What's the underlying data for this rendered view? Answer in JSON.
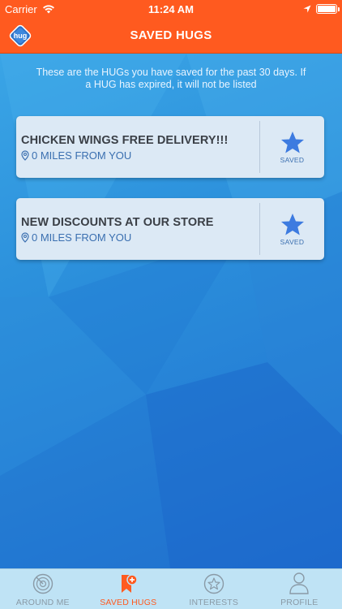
{
  "status_bar": {
    "carrier": "Carrier",
    "time": "11:24 AM"
  },
  "nav": {
    "title": "SAVED HUGS",
    "logo_text": "hug"
  },
  "intro_text": "These are the HUGs you have saved for the past 30 days. If a HUG has expired, it will not be listed",
  "cards": [
    {
      "title": "CHICKEN WINGS FREE DELIVERY!!!",
      "distance": "0 MILES FROM YOU",
      "saved_label": "SAVED"
    },
    {
      "title": "NEW DISCOUNTS AT OUR STORE",
      "distance": "0 MILES FROM YOU",
      "saved_label": "SAVED"
    }
  ],
  "tabs": [
    {
      "label": "AROUND ME",
      "icon": "radar-icon",
      "active": false
    },
    {
      "label": "SAVED HUGS",
      "icon": "bookmark-plus-icon",
      "active": true
    },
    {
      "label": "INTERESTS",
      "icon": "star-circle-icon",
      "active": false
    },
    {
      "label": "PROFILE",
      "icon": "person-icon",
      "active": false
    }
  ],
  "colors": {
    "brand_orange": "#ff5a1f",
    "accent_blue": "#3a6fb0",
    "star_blue": "#3d7be0"
  }
}
